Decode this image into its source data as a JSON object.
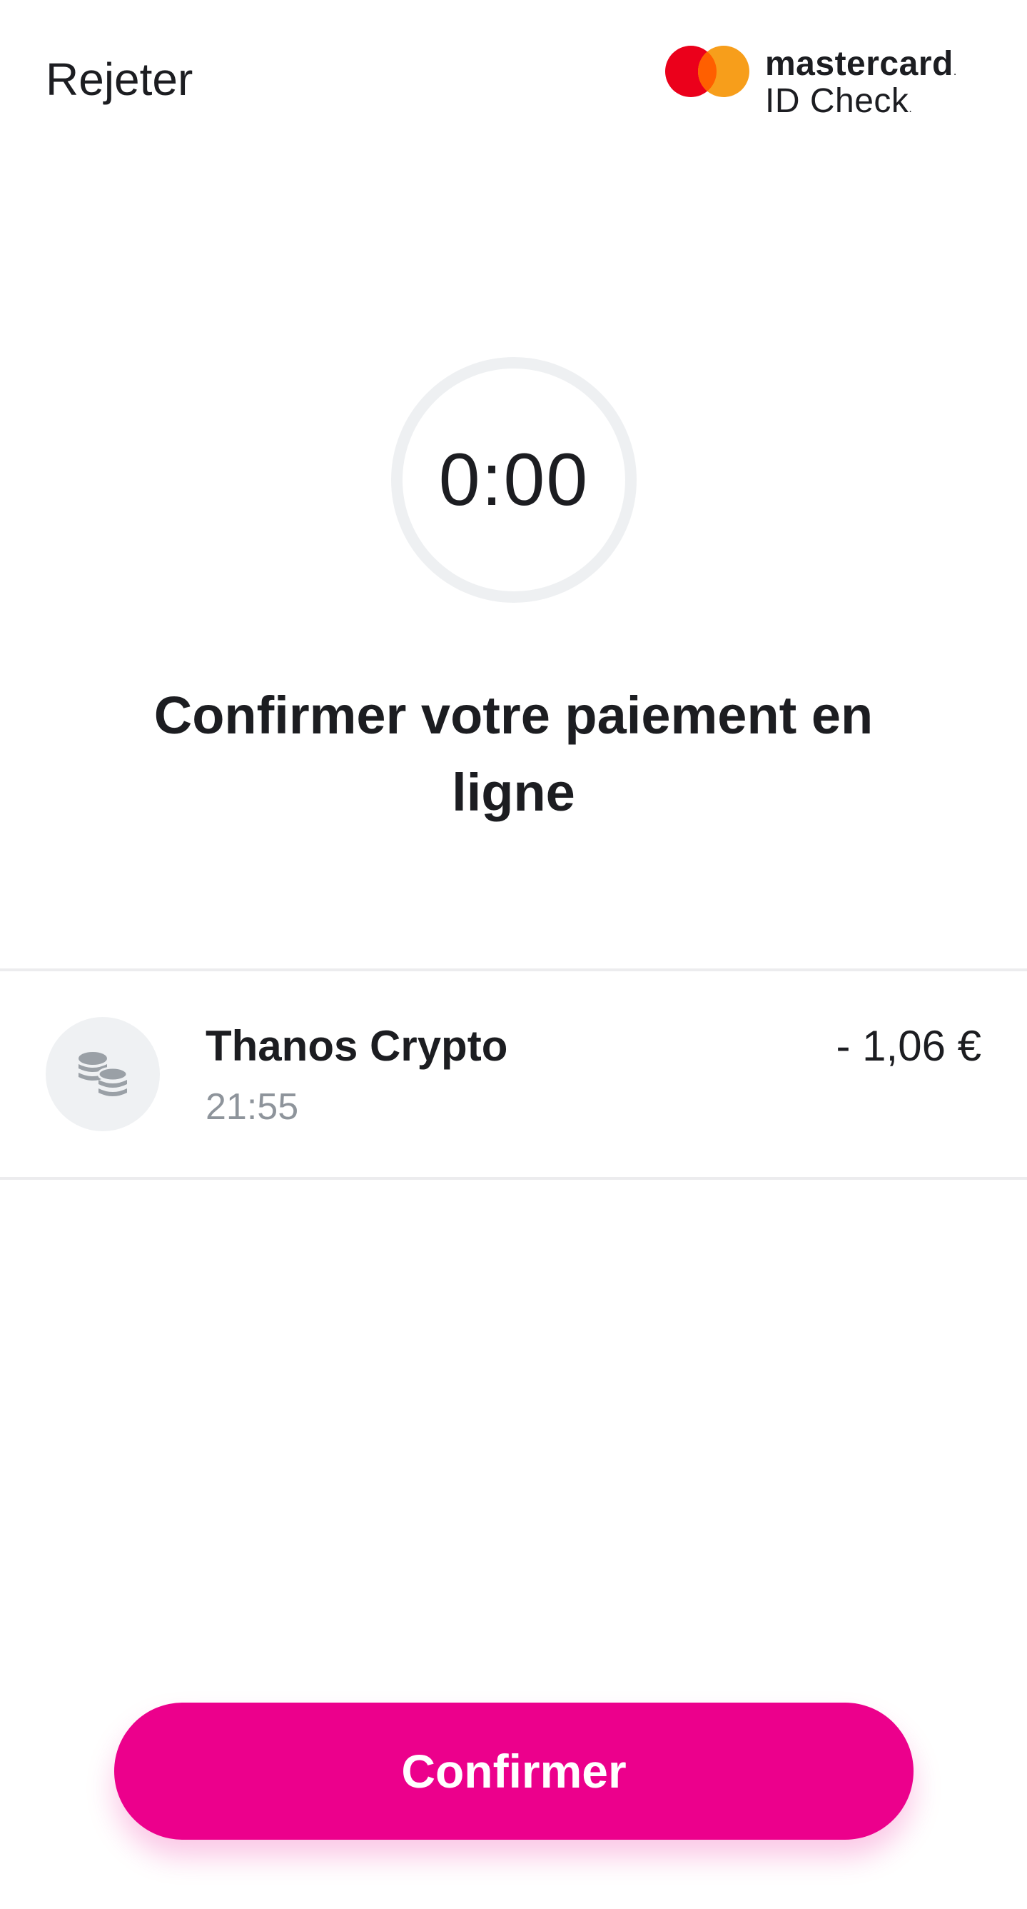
{
  "header": {
    "reject_label": "Rejeter",
    "brand": {
      "name": "mastercard",
      "sub": "ID Check",
      "trademark": ".",
      "colors": {
        "red": "#eb001b",
        "orange": "#f79e1b",
        "overlap": "#ff5f00"
      }
    }
  },
  "timer": {
    "value": "0:00"
  },
  "title": "Confirmer votre paiement en ligne",
  "transaction": {
    "icon": "coins-icon",
    "merchant": "Thanos Crypto",
    "time": "21:55",
    "amount": "- 1,06 €"
  },
  "actions": {
    "confirm_label": "Confirmer",
    "accent_color": "#ec008c"
  }
}
